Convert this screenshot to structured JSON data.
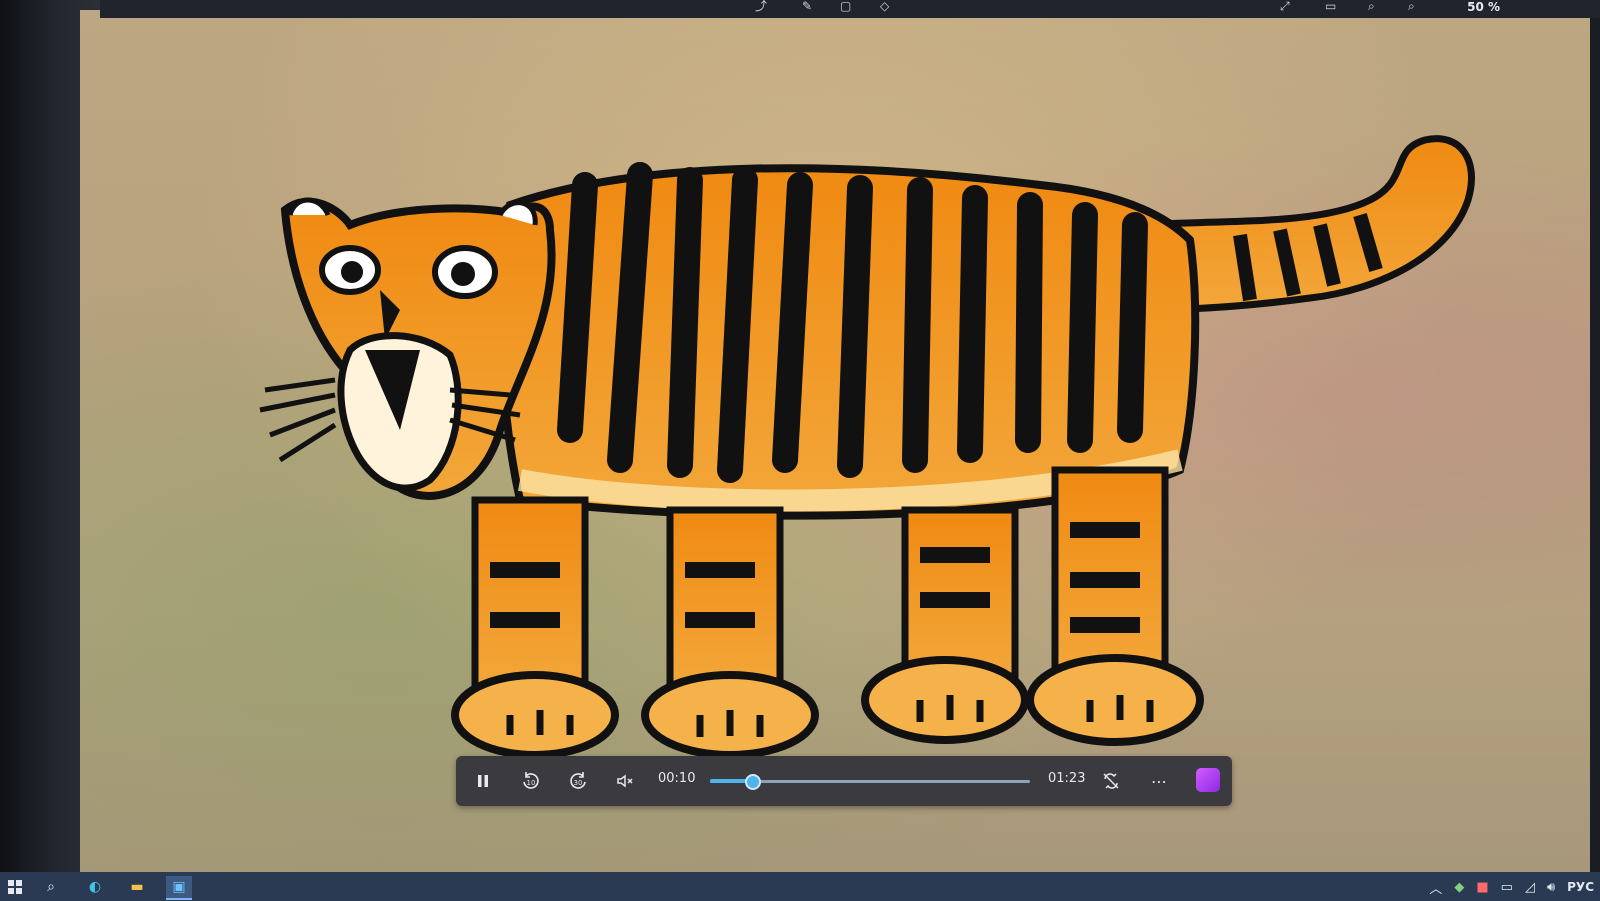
{
  "top_bar": {
    "zoom_label": "50 %",
    "icons": [
      "share-icon",
      "pen-icon",
      "save-icon",
      "tag-icon",
      "fullscreen-icon",
      "window-icon",
      "zoom-out-icon",
      "zoom-in-icon"
    ]
  },
  "player": {
    "current_time": "00:10",
    "total_time": "01:23",
    "progress_fraction": 0.13,
    "controls": {
      "play_pause": "pause-icon",
      "skip_back": "10",
      "skip_forward": "30",
      "volume": "mute-icon",
      "loop": "repeat-off-icon",
      "more": "⋯",
      "app": "clipchamp-icon"
    }
  },
  "taskbar": {
    "items": [
      "start-icon",
      "search-icon",
      "edge-icon",
      "file-explorer-icon",
      "photos-app-icon"
    ],
    "tray": {
      "icons": [
        "chevron-up-icon",
        "security-icon",
        "app-tray-icon",
        "display-icon",
        "network-icon",
        "volume-icon"
      ],
      "language": "РУС"
    }
  },
  "colors": {
    "accent": "#4fb3ee",
    "controls_bg": "#3a3a3f",
    "taskbar_bg": "#2a3a52"
  }
}
